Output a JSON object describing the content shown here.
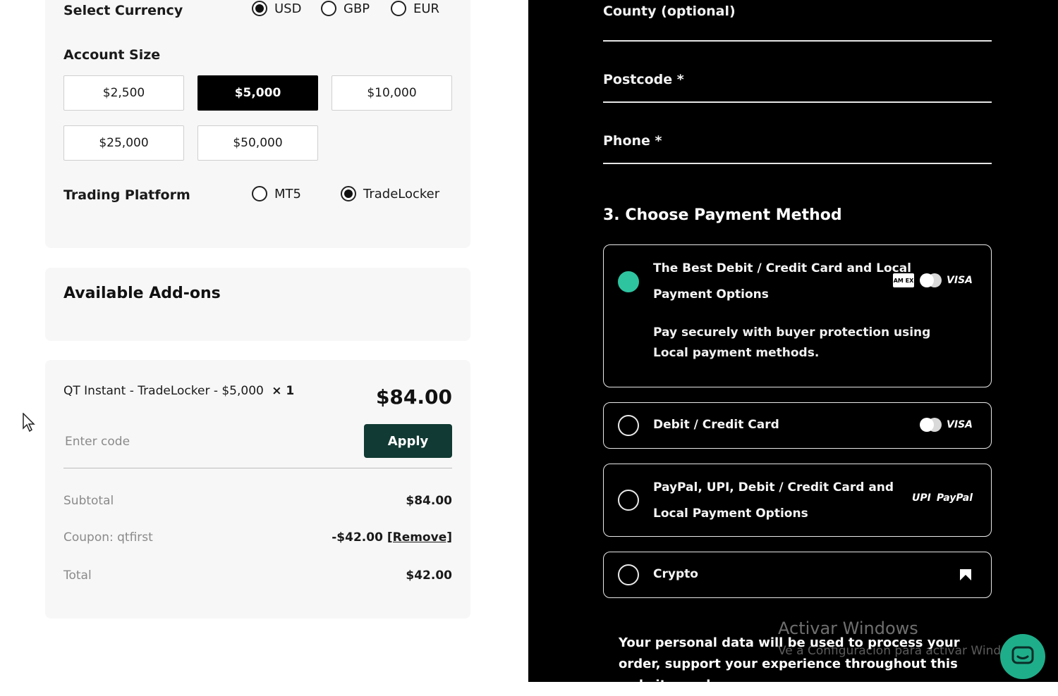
{
  "config": {
    "currency_label": "Select Currency",
    "currencies": [
      {
        "label": "USD",
        "selected": true
      },
      {
        "label": "GBP",
        "selected": false
      },
      {
        "label": "EUR",
        "selected": false
      }
    ],
    "account_size_label": "Account Size",
    "sizes": [
      "$2,500",
      "$5,000",
      "$10,000",
      "$25,000",
      "$50,000"
    ],
    "selected_size": "$5,000",
    "platform_label": "Trading Platform",
    "platforms": [
      {
        "label": "MT5",
        "selected": false
      },
      {
        "label": "TradeLocker",
        "selected": true
      }
    ]
  },
  "addons": {
    "title": "Available Add-ons"
  },
  "summary": {
    "product": "QT Instant - TradeLocker - $5,000",
    "quantity": "× 1",
    "price": "$84.00",
    "code_placeholder": "Enter code",
    "apply_label": "Apply",
    "subtotal_label": "Subtotal",
    "subtotal_value": "$84.00",
    "coupon_label": "Coupon: qtfirst",
    "coupon_value": "-$42.00",
    "remove_label": "[Remove]",
    "total_label": "Total",
    "total_value": "$42.00"
  },
  "billing": {
    "county_label": "County (optional)",
    "postcode_label": "Postcode *",
    "phone_label": "Phone *"
  },
  "payment": {
    "section_title": "3. Choose Payment Method",
    "options": [
      {
        "title_line1": "The Best Debit / Credit Card and Local",
        "title_line2": "Payment Options",
        "description": "Pay securely with buyer protection using Local payment methods.",
        "selected": true
      },
      {
        "title": "Debit / Credit Card",
        "selected": false
      },
      {
        "title_line1": "PayPal, UPI, Debit / Credit Card and",
        "title_line2": "Local Payment Options",
        "selected": false
      },
      {
        "title": "Crypto",
        "selected": false
      }
    ],
    "visa_label": "VISA",
    "amex_label": "AM EX",
    "upi_label": "UPI",
    "paypal_label": "PayPal"
  },
  "consent_text": "Your personal data will be used to process your order, support your experience throughout this website, and",
  "watermark": {
    "title": "Activar Windows",
    "subtitle": "Ve a Configuración para activar Windows."
  },
  "colors": {
    "accent": "#2ec4a0",
    "apply_button": "#103a33"
  }
}
